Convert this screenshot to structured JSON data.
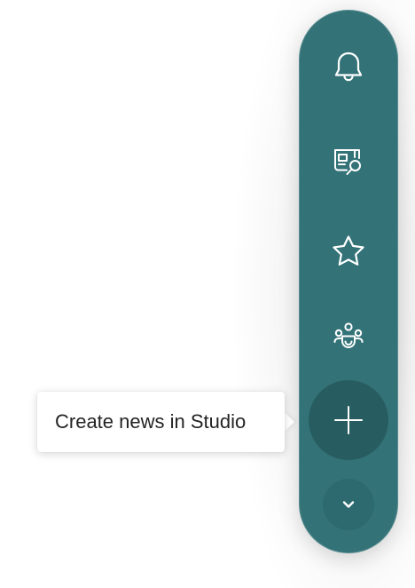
{
  "rail": {
    "buttons": [
      {
        "name": "notifications",
        "icon": "bell-icon"
      },
      {
        "name": "news-search",
        "icon": "news-search-icon"
      },
      {
        "name": "favorites",
        "icon": "star-icon"
      },
      {
        "name": "people",
        "icon": "people-group-icon"
      },
      {
        "name": "create-news",
        "icon": "plus-icon"
      },
      {
        "name": "expand-more",
        "icon": "chevron-down-icon"
      }
    ],
    "colors": {
      "rail": "#337378",
      "create_button": "#275d61",
      "more_button": "#2c6a6f"
    }
  },
  "tooltip": {
    "text": "Create news in Studio"
  }
}
